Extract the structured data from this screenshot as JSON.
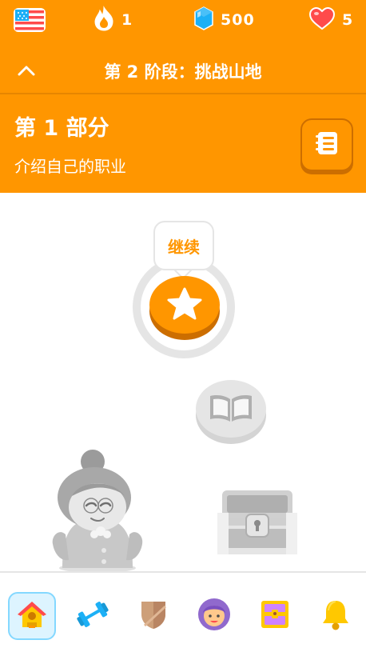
{
  "stats": {
    "language": "English (US)",
    "streak": "1",
    "gems": "500",
    "hearts": "5"
  },
  "section": {
    "title": "第 2 阶段：挑战山地"
  },
  "unit": {
    "title": "第 1 部分",
    "subtitle": "介绍自己的职业"
  },
  "path": {
    "tooltip": "继续",
    "nodes": [
      {
        "icon": "star-icon",
        "state": "active"
      },
      {
        "icon": "book-icon",
        "state": "locked"
      },
      {
        "icon": "chest-icon",
        "state": "locked"
      }
    ]
  },
  "colors": {
    "header": "#ff9600",
    "header_dark": "#cc6e00",
    "locked": "#e5e5e5",
    "nav_active_bg": "#ddf4ff",
    "nav_active_border": "#84d8ff"
  },
  "nav": {
    "items": [
      {
        "icon": "home-icon",
        "active": true
      },
      {
        "icon": "dumbbell-icon",
        "active": false
      },
      {
        "icon": "shield-icon",
        "active": false
      },
      {
        "icon": "profile-icon",
        "active": false
      },
      {
        "icon": "quest-chest-icon",
        "active": false
      },
      {
        "icon": "bell-icon",
        "active": false
      }
    ]
  }
}
